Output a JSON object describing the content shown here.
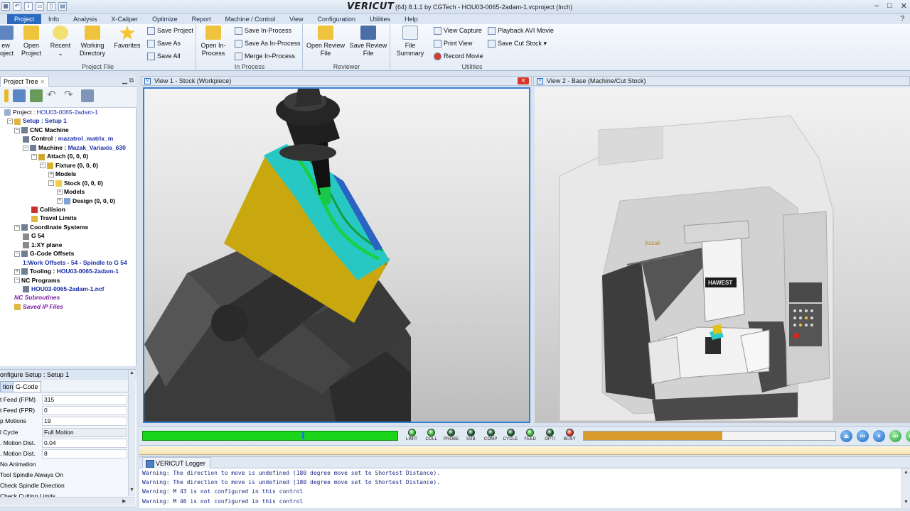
{
  "window": {
    "brand": "VERICUT",
    "title": "(64)  8.1.1 by CGTech - HOU03-0065-2adam-1.vcproject (Inch)",
    "controls": [
      "–",
      "□",
      "✕"
    ],
    "help": "?"
  },
  "menu": [
    "Project",
    "Info",
    "Analysis",
    "X-Caliper",
    "Optimize",
    "Report",
    "Machine / Control",
    "View",
    "Configuration",
    "Utilities",
    "Help"
  ],
  "ribbon": {
    "project_file": {
      "title": "Project File",
      "new_label": "ew\nroject",
      "open_label": "Open\nProject",
      "recent_label": "Recent",
      "working_dir_label": "Working\nDirectory",
      "favorites_label": "Favorites",
      "save_project": "Save Project",
      "save_as": "Save As",
      "save_all": "Save All"
    },
    "in_process": {
      "title": "In Process",
      "open_label": "Open In-\nProcess",
      "save": "Save In-Process",
      "save_as": "Save As In-Process",
      "merge": "Merge In-Process"
    },
    "reviewer": {
      "title": "Reviewer",
      "open_label": "Open Review\nFile",
      "save_label": "Save Review\nFile"
    },
    "utilities": {
      "title": "Utilities",
      "file_summary": "File\nSummary",
      "view_capture": "View Capture",
      "print_view": "Print View",
      "record_movie": "Record Movie",
      "playback": "Playback AVI Movie",
      "save_cut_stock": "Save Cut Stock"
    }
  },
  "project_tree": {
    "tab": "Project Tree",
    "nodes": [
      {
        "label": "Project : ",
        "value": "HOU03-0065-2adam-1",
        "style": "plain"
      },
      {
        "label": "Setup : ",
        "value": "Setup 1",
        "style": "blue"
      },
      {
        "label": "CNC Machine",
        "value": "",
        "style": "bold"
      },
      {
        "label": "Control : ",
        "value": "mazatrol_matrix_m",
        "style": "bold"
      },
      {
        "label": "Machine : ",
        "value": "Mazak_Variaxis_630",
        "style": "bold"
      },
      {
        "label": "Attach (0, 0, 0)",
        "value": "",
        "style": "bold"
      },
      {
        "label": "Fixture (0, 0, 0)",
        "value": "",
        "style": "bold"
      },
      {
        "label": "Models",
        "value": "",
        "style": "bold"
      },
      {
        "label": "Stock (0, 0, 0)",
        "value": "",
        "style": "bold"
      },
      {
        "label": "Models",
        "value": "",
        "style": "bold"
      },
      {
        "label": "Design (0, 0, 0)",
        "value": "",
        "style": "bold"
      },
      {
        "label": "Collision",
        "value": "",
        "style": "bold"
      },
      {
        "label": "Travel Limits",
        "value": "",
        "style": "bold"
      },
      {
        "label": "Coordinate Systems",
        "value": "",
        "style": "bold"
      },
      {
        "label": "G 54",
        "value": "",
        "style": "bold"
      },
      {
        "label": "1:XY plane",
        "value": "",
        "style": "bold"
      },
      {
        "label": "G-Code Offsets",
        "value": "",
        "style": "bold"
      },
      {
        "label": "1:Work Offsets - 54 - Spindle to G 54",
        "value": "",
        "style": "blue"
      },
      {
        "label": "Tooling : ",
        "value": "HOU03-0065-2adam-1",
        "style": "bold"
      },
      {
        "label": "NC Programs",
        "value": "",
        "style": "bold"
      },
      {
        "label": "HOU03-0065-2adam-1.ncf",
        "value": "",
        "style": "blue"
      },
      {
        "label": "NC Subroutines",
        "value": "",
        "style": "purple"
      },
      {
        "label": "Saved IP Files",
        "value": "",
        "style": "purple"
      }
    ]
  },
  "configure_setup": {
    "title": "onfigure Setup : Setup 1",
    "tabs": [
      "tion",
      "G-Code"
    ],
    "rows": [
      {
        "label": "t Feed (FPM)",
        "value": "315"
      },
      {
        "label": "t Feed (FPR)",
        "value": "0"
      },
      {
        "label": "p Motions",
        "value": "19"
      },
      {
        "label": "l Cycle",
        "value": "Full Motion"
      },
      {
        "label": ". Motion Dist.",
        "value": "0.04"
      },
      {
        "label": ". Motion Dist.",
        "value": "8"
      }
    ],
    "options": [
      "No Animation",
      "Tool Spindle Always On",
      "Check Spindle Direction",
      "Check Cutting Limits"
    ]
  },
  "views": {
    "view1_title": "View 1 - Stock (Workpiece)",
    "view2_title": "View 2 - Base (Machine/Cut Stock)",
    "close_glyph": "✕",
    "machine_brand": "HAWEST",
    "machine_logo": "frazak"
  },
  "simulation": {
    "progress": 0.62,
    "secondary_progress": 0.55,
    "leds": [
      {
        "label": "LIMIT",
        "color": "#2fb82f"
      },
      {
        "label": "COLL",
        "color": "#2fb82f"
      },
      {
        "label": "PROBE",
        "color": "#155a2a"
      },
      {
        "label": "SUB",
        "color": "#155a2a"
      },
      {
        "label": "COMP",
        "color": "#155a2a"
      },
      {
        "label": "CYCLE",
        "color": "#155a2a"
      },
      {
        "label": "FEED",
        "color": "#2fb82f"
      },
      {
        "label": "OPTI",
        "color": "#155a2a"
      },
      {
        "label": "BUSY",
        "color": "#d8261c"
      }
    ],
    "buttons": [
      "⏏",
      "⏮",
      "⏸",
      "⏭",
      "⏭"
    ]
  },
  "logger": {
    "tab": "VERICUT Logger",
    "lines": [
      "Warning: The direction to move is undefined (180 degree move set to Shortest Distance).",
      "Warning: The direction to move is undefined (180 degree move set to Shortest Distance).",
      "Warning: M 43 is not configured in this control",
      "Warning: M 46 is not configured in this control"
    ]
  }
}
